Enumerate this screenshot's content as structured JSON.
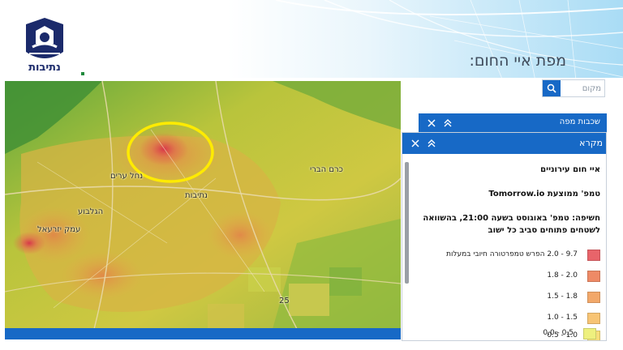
{
  "header": {
    "logo_text": "נתיבות",
    "title": "מפת איי החום:"
  },
  "search": {
    "placeholder": "מקום",
    "icon": "search-icon"
  },
  "map": {
    "labels": [
      {
        "id": "city",
        "text": "נתיבות"
      },
      {
        "id": "north",
        "text": "נחל ערים"
      },
      {
        "id": "east",
        "text": "כרם הברי"
      },
      {
        "id": "sw1",
        "text": "עמק יזרעאל"
      },
      {
        "id": "sw2",
        "text": "הגלבוע"
      },
      {
        "id": "road",
        "text": "25"
      }
    ],
    "highlight_color": "#ffeb00"
  },
  "layers_panel": {
    "title": "שכבות מפה",
    "close_icon": "close-icon",
    "collapse_icon": "chevron-double-up-icon"
  },
  "legend_panel": {
    "title": "מקרא",
    "close_icon": "close-icon",
    "collapse_icon": "chevron-double-up-icon",
    "layer_name": "איי חום עירוניים",
    "source": "טמפ' ממוצעת Tomorrow.io",
    "description": "חשיפה: טמפ' באוגוסט בשעה 21:00, בהשוואה לשטחים פתוחים סביב כל ישוב",
    "items": [
      {
        "label": "9.7 - 2.0 הפרש טמפרטורה חיובי במעלות",
        "color": "#e8646a"
      },
      {
        "label": "2.0 - 1.8",
        "color": "#ee8a66"
      },
      {
        "label": "1.8 - 1.5",
        "color": "#f2a86a"
      },
      {
        "label": "1.5 - 1.0",
        "color": "#f7c474"
      },
      {
        "label": "1.0 - 0.5",
        "color": "#f7de7a"
      },
      {
        "label": "0.5 - 0.0",
        "color": "#eef07e"
      }
    ]
  },
  "colors": {
    "accent": "#1769c6",
    "header_art": "#bfe6f8"
  }
}
